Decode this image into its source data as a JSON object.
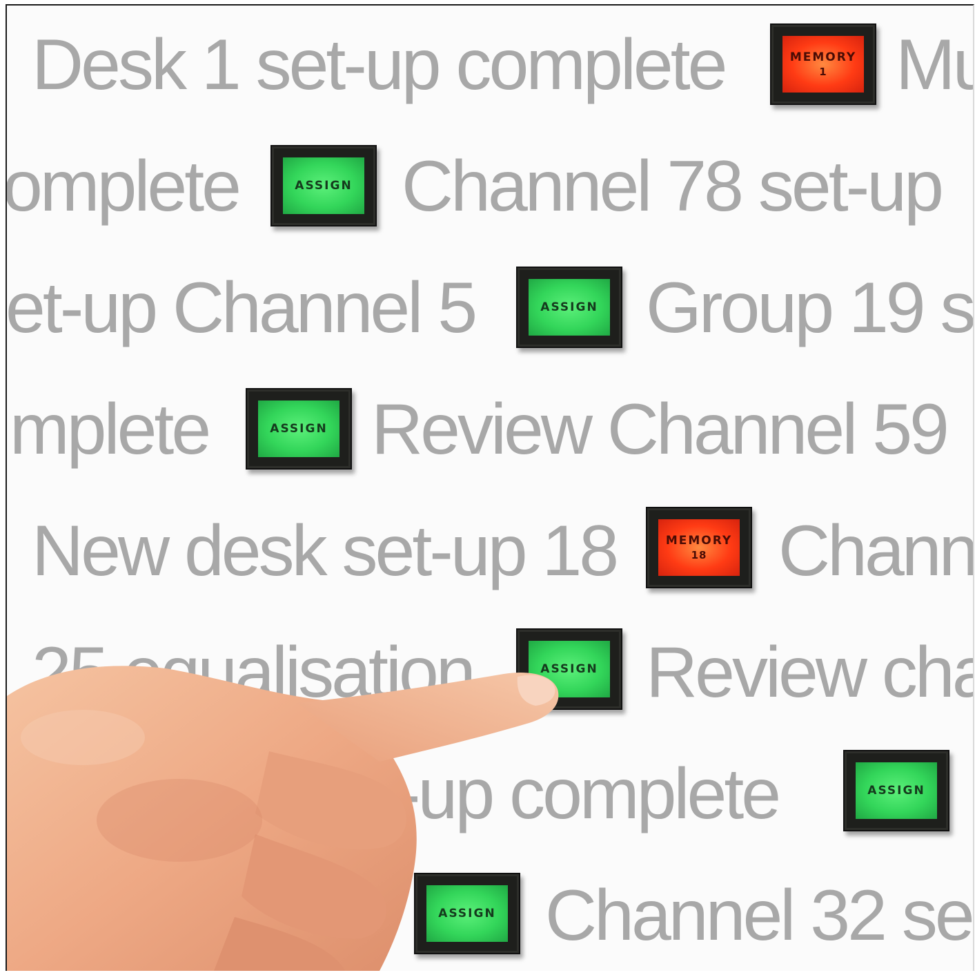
{
  "rows": [
    {
      "before": "Desk 1 set-up complete",
      "button": {
        "kind": "red",
        "label": "MEMORY",
        "sub": "1"
      },
      "after": "Mu"
    },
    {
      "before": "omplete",
      "button": {
        "kind": "green",
        "label": "ASSIGN"
      },
      "after": "Channel 78 set-up"
    },
    {
      "before": "et-up Channel 5",
      "button": {
        "kind": "green",
        "label": "ASSIGN"
      },
      "after": "Group 19 se"
    },
    {
      "before": "mplete",
      "button": {
        "kind": "green",
        "label": "ASSIGN"
      },
      "after": "Review Channel 59"
    },
    {
      "before": "New desk set-up 18",
      "button": {
        "kind": "red",
        "label": "MEMORY",
        "sub": "18"
      },
      "after": "Chann"
    },
    {
      "before": "25 equalisation",
      "button": {
        "kind": "green",
        "label": "ASSIGN"
      },
      "after": "Review cha"
    },
    {
      "before": "t-up complete",
      "button": {
        "kind": "green",
        "label": "ASSIGN"
      },
      "after": ""
    },
    {
      "before": "",
      "button": {
        "kind": "green",
        "label": "ASSIGN"
      },
      "after": "Channel 32 se"
    }
  ],
  "colors": {
    "text": "#a8a8a8",
    "green_lens": "#33d65a",
    "red_lens": "#ff3b14",
    "bezel": "#1e1f1c",
    "skin": "#f2b48f"
  }
}
